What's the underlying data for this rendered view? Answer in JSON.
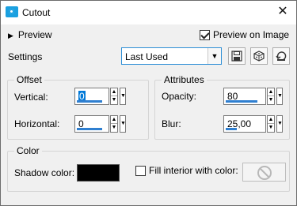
{
  "window": {
    "title": "Cutout",
    "close_glyph": "✕"
  },
  "preview": {
    "toggle_label": "Preview",
    "preview_on_image_label": "Preview on Image",
    "preview_on_image_checked": true
  },
  "settings": {
    "label": "Settings",
    "selected": "Last Used"
  },
  "toolbar": {
    "icons": [
      "save-icon",
      "randomize-icon",
      "reset-icon"
    ]
  },
  "offset": {
    "group_label": "Offset",
    "vertical": {
      "label": "Vertical:",
      "value": "0"
    },
    "horizontal": {
      "label": "Horizontal:",
      "value": "0"
    }
  },
  "attributes": {
    "group_label": "Attributes",
    "opacity": {
      "label": "Opacity:",
      "value": "80"
    },
    "blur": {
      "label": "Blur:",
      "value": "25,00"
    }
  },
  "color": {
    "group_label": "Color",
    "shadow_color_label": "Shadow color:",
    "shadow_color": "#000000",
    "fill_interior_label": "Fill interior with color:",
    "fill_interior_checked": false
  },
  "colors": {
    "accent": "#0078d7",
    "app_icon": "#1aa0e0"
  }
}
